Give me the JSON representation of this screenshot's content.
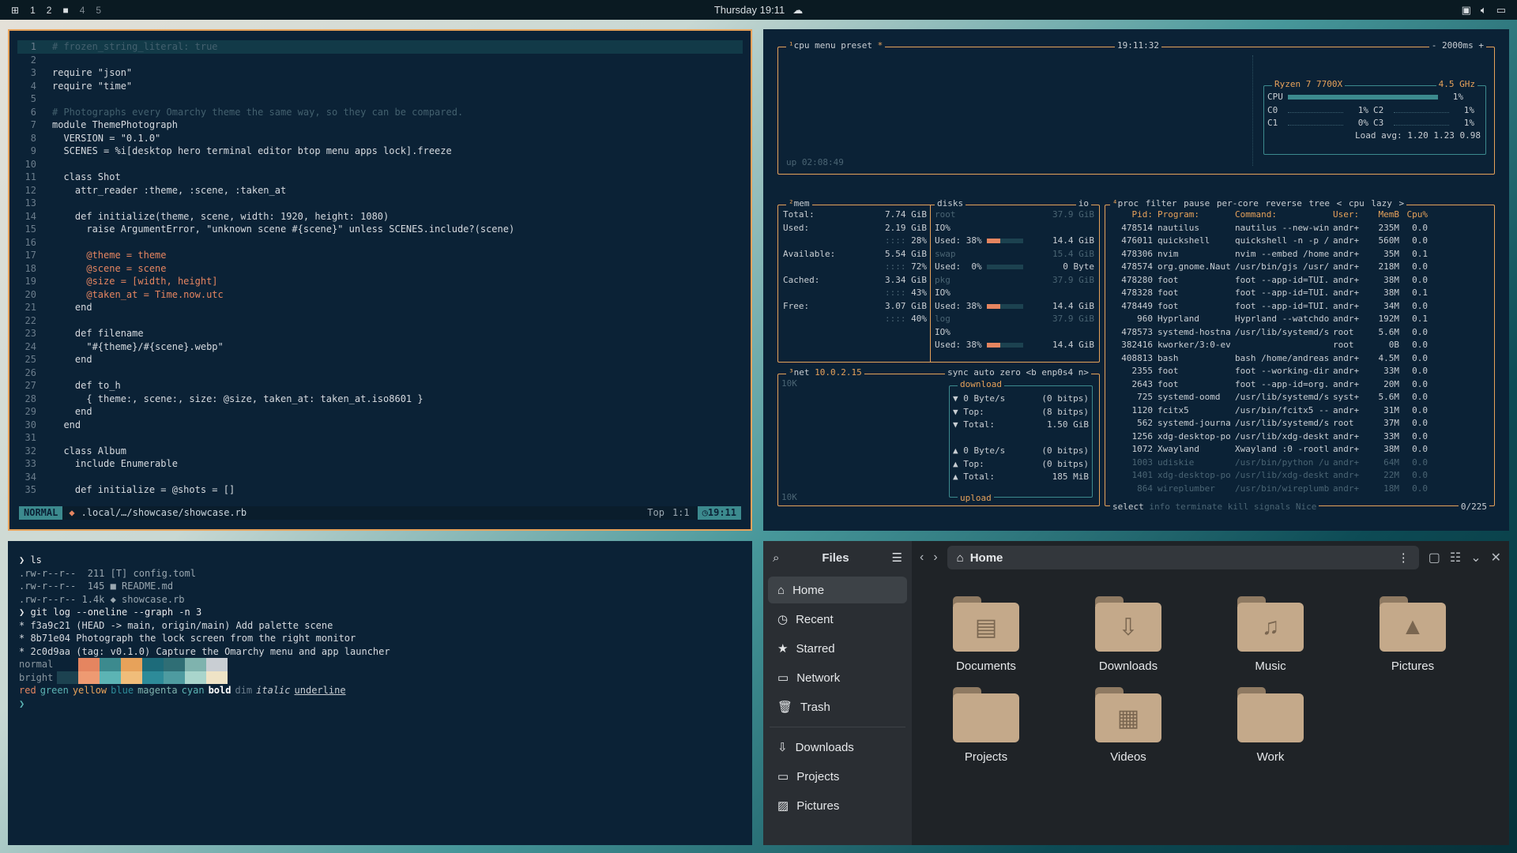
{
  "topbar": {
    "workspaces": [
      "1",
      "2",
      "3",
      "4",
      "5"
    ],
    "active_workspace": "3",
    "clock": "Thursday 19:11"
  },
  "editor": {
    "lines": [
      {
        "n": "1",
        "t": "# frozen_string_literal: true"
      },
      {
        "n": "2",
        "t": ""
      },
      {
        "n": "3",
        "t": "require \"json\""
      },
      {
        "n": "4",
        "t": "require \"time\""
      },
      {
        "n": "5",
        "t": ""
      },
      {
        "n": "6",
        "t": "# Photographs every Omarchy theme the same way, so they can be compared."
      },
      {
        "n": "7",
        "t": "module ThemePhotograph"
      },
      {
        "n": "8",
        "t": "  VERSION = \"0.1.0\""
      },
      {
        "n": "9",
        "t": "  SCENES = %i[desktop hero terminal editor btop menu apps lock].freeze"
      },
      {
        "n": "10",
        "t": ""
      },
      {
        "n": "11",
        "t": "  class Shot"
      },
      {
        "n": "12",
        "t": "    attr_reader :theme, :scene, :taken_at"
      },
      {
        "n": "13",
        "t": ""
      },
      {
        "n": "14",
        "t": "    def initialize(theme, scene, width: 1920, height: 1080)"
      },
      {
        "n": "15",
        "t": "      raise ArgumentError, \"unknown scene #{scene}\" unless SCENES.include?(scene)"
      },
      {
        "n": "16",
        "t": ""
      },
      {
        "n": "17",
        "t": "      @theme = theme"
      },
      {
        "n": "18",
        "t": "      @scene = scene"
      },
      {
        "n": "19",
        "t": "      @size = [width, height]"
      },
      {
        "n": "20",
        "t": "      @taken_at = Time.now.utc"
      },
      {
        "n": "21",
        "t": "    end"
      },
      {
        "n": "22",
        "t": ""
      },
      {
        "n": "23",
        "t": "    def filename"
      },
      {
        "n": "24",
        "t": "      \"#{theme}/#{scene}.webp\""
      },
      {
        "n": "25",
        "t": "    end"
      },
      {
        "n": "26",
        "t": ""
      },
      {
        "n": "27",
        "t": "    def to_h"
      },
      {
        "n": "28",
        "t": "      { theme:, scene:, size: @size, taken_at: taken_at.iso8601 }"
      },
      {
        "n": "29",
        "t": "    end"
      },
      {
        "n": "30",
        "t": "  end"
      },
      {
        "n": "31",
        "t": ""
      },
      {
        "n": "32",
        "t": "  class Album"
      },
      {
        "n": "33",
        "t": "    include Enumerable"
      },
      {
        "n": "34",
        "t": ""
      },
      {
        "n": "35",
        "t": "    def initialize = @shots = []"
      }
    ],
    "status": {
      "mode": "NORMAL",
      "path": ".local/…/showcase/showcase.rb",
      "pos": "Top",
      "cursor": "1:1",
      "time": "19:11"
    }
  },
  "btop": {
    "cpu": {
      "tabs": [
        "cpu",
        "menu",
        "preset"
      ],
      "time": "19:11:32",
      "rate": "2000ms",
      "model": "Ryzen 7 7700X",
      "freq": "4.5 GHz",
      "rows": [
        {
          "l": "CPU",
          "v": "1%",
          "r": "",
          "rv": ""
        },
        {
          "l": "C0",
          "v": "1%",
          "r": "C2",
          "rv": "1%"
        },
        {
          "l": "C1",
          "v": "0%",
          "r": "C3",
          "rv": "1%"
        }
      ],
      "load": "Load avg: 1.20 1.23 0.98",
      "uptime": "up 02:08:49"
    },
    "mem": {
      "title": "mem",
      "rows": [
        {
          "k": "Total:",
          "v": "7.74 GiB",
          "p": ""
        },
        {
          "k": "Used:",
          "v": "2.19 GiB",
          "p": "28%"
        },
        {
          "k": "Available:",
          "v": "5.54 GiB",
          "p": "72%"
        },
        {
          "k": "Cached:",
          "v": "3.34 GiB",
          "p": "43%"
        },
        {
          "k": "Free:",
          "v": "3.07 GiB",
          "p": "40%"
        }
      ]
    },
    "disks": {
      "title": "disks",
      "io": "io",
      "rows": [
        {
          "name": "root",
          "size": "37.9 GiB",
          "io": "IO%",
          "used": "Used: 38%",
          "usedv": "14.4 GiB",
          "pct": 0.38
        },
        {
          "name": "swap",
          "size": "15.4 GiB",
          "io": "",
          "used": "Used:  0%",
          "usedv": "0 Byte",
          "pct": 0.0
        },
        {
          "name": "pkg",
          "size": "37.9 GiB",
          "io": "IO%",
          "used": "Used: 38%",
          "usedv": "14.4 GiB",
          "pct": 0.38
        },
        {
          "name": "log",
          "size": "37.9 GiB",
          "io": "IO%",
          "used": "Used: 38%",
          "usedv": "14.4 GiB",
          "pct": 0.38
        }
      ]
    },
    "net": {
      "title": "net",
      "ip": "10.0.2.15",
      "opts": [
        "sync",
        "auto",
        "zero"
      ],
      "iface": "enp0s4",
      "scale_top": "10K",
      "scale_bot": "10K",
      "download_label": "download",
      "upload_label": "upload",
      "down": [
        {
          "k": "▼ 0 Byte/s",
          "v": "(0 bitps)"
        },
        {
          "k": "▼ Top:",
          "v": "(8 bitps)"
        },
        {
          "k": "▼ Total:",
          "v": "1.50 GiB"
        }
      ],
      "up": [
        {
          "k": "▲ 0 Byte/s",
          "v": "(0 bitps)"
        },
        {
          "k": "▲ Top:",
          "v": "(0 bitps)"
        },
        {
          "k": "▲ Total:",
          "v": "185 MiB"
        }
      ]
    },
    "proc": {
      "tabs": [
        "proc",
        "filter",
        "pause",
        "per-core",
        "reverse",
        "tree",
        "< cpu lazy >"
      ],
      "headers": [
        "Pid:",
        "Program:",
        "Command:",
        "User:",
        "MemB",
        "Cpu%"
      ],
      "rows": [
        [
          "478514",
          "nautilus",
          "nautilus --new-win",
          "andr+",
          "235M",
          "0.0"
        ],
        [
          "476011",
          "quickshell",
          "quickshell -n -p /",
          "andr+",
          "560M",
          "0.0"
        ],
        [
          "478306",
          "nvim",
          "nvim --embed /home",
          "andr+",
          "35M",
          "0.1"
        ],
        [
          "478574",
          "org.gnome.Nauti",
          "/usr/bin/gjs /usr/",
          "andr+",
          "218M",
          "0.0"
        ],
        [
          "478280",
          "foot",
          "foot --app-id=TUI.",
          "andr+",
          "38M",
          "0.0"
        ],
        [
          "478328",
          "foot",
          "foot --app-id=TUI.",
          "andr+",
          "38M",
          "0.1"
        ],
        [
          "478449",
          "foot",
          "foot --app-id=TUI.",
          "andr+",
          "34M",
          "0.0"
        ],
        [
          "960",
          "Hyprland",
          "Hyprland --watchdo",
          "andr+",
          "192M",
          "0.1"
        ],
        [
          "478573",
          "systemd-hostnam",
          "/usr/lib/systemd/s",
          "root",
          "5.6M",
          "0.0"
        ],
        [
          "382416",
          "kworker/3:0-even",
          "",
          "root",
          "0B",
          "0.0"
        ],
        [
          "408813",
          "bash",
          "bash /home/andreas",
          "andr+",
          "4.5M",
          "0.0"
        ],
        [
          "2355",
          "foot",
          "foot --working-dir",
          "andr+",
          "33M",
          "0.0"
        ],
        [
          "2643",
          "foot",
          "foot --app-id=org.",
          "andr+",
          "20M",
          "0.0"
        ],
        [
          "725",
          "systemd-oomd",
          "/usr/lib/systemd/s",
          "syst+",
          "5.6M",
          "0.0"
        ],
        [
          "1120",
          "fcitx5",
          "/usr/bin/fcitx5 --",
          "andr+",
          "31M",
          "0.0"
        ],
        [
          "562",
          "systemd-journal",
          "/usr/lib/systemd/s",
          "root",
          "37M",
          "0.0"
        ],
        [
          "1256",
          "xdg-desktop-por",
          "/usr/lib/xdg-deskt",
          "andr+",
          "33M",
          "0.0"
        ],
        [
          "1072",
          "Xwayland",
          "Xwayland :0 -rootl",
          "andr+",
          "38M",
          "0.0"
        ],
        [
          "1003",
          "udiskie",
          "/usr/bin/python /u",
          "andr+",
          "64M",
          "0.0"
        ],
        [
          "1401",
          "xdg-desktop-por",
          "/usr/lib/xdg-deskt",
          "andr+",
          "22M",
          "0.0"
        ],
        [
          "864",
          "wireplumber",
          "/usr/bin/wireplumb",
          "andr+",
          "18M",
          "0.0"
        ]
      ],
      "footer": [
        "select",
        "info",
        "terminate",
        "kill",
        "signals",
        "Nice"
      ],
      "count": "0/225"
    }
  },
  "terminal": {
    "lines": [
      {
        "t": "❯ ls"
      },
      {
        "t": ".rw-r--r--  211 [T] config.toml"
      },
      {
        "t": ".rw-r--r--  145 ■ README.md"
      },
      {
        "t": ".rw-r--r-- 1.4k ◆ showcase.rb"
      },
      {
        "t": "❯ git log --oneline --graph -n 3"
      },
      {
        "t": "* f3a9c21 (HEAD -> main, origin/main) Add palette scene"
      },
      {
        "t": "* 8b71e04 Photograph the lock screen from the right monitor"
      },
      {
        "t": "* 2c0d9aa (tag: v0.1.0) Capture the Omarchy menu and app launcher"
      }
    ],
    "normal_label": "normal",
    "bright_label": "bright",
    "normal_colors": [
      "#0b2236",
      "#e58560",
      "#3c8a8e",
      "#e7a25a",
      "#1d6b7a",
      "#2f6e75",
      "#7fb3ae",
      "#c9ced3"
    ],
    "bright_colors": [
      "#1c4250",
      "#ee9a72",
      "#5cb4b4",
      "#f0bd7a",
      "#2d8b99",
      "#4e9ba0",
      "#a9d5cc",
      "#efe3c6"
    ],
    "styles": [
      "red",
      "green",
      "yellow",
      "blue",
      "magenta",
      "cyan",
      "bold",
      "dim",
      "italic",
      "underline"
    ],
    "prompt": "❯"
  },
  "files": {
    "title": "Files",
    "location": "Home",
    "sidebar": [
      "Home",
      "Recent",
      "Starred",
      "Network",
      "Trash"
    ],
    "bookmarks": [
      "Downloads",
      "Projects",
      "Pictures"
    ],
    "folders": [
      {
        "name": "Documents",
        "icon": "document-icon",
        "glyph": "▤"
      },
      {
        "name": "Downloads",
        "icon": "download-icon",
        "glyph": "⇩"
      },
      {
        "name": "Music",
        "icon": "music-icon",
        "glyph": "♫"
      },
      {
        "name": "Pictures",
        "icon": "picture-icon",
        "glyph": "▲"
      },
      {
        "name": "Projects",
        "icon": "folder-icon",
        "glyph": ""
      },
      {
        "name": "Videos",
        "icon": "video-icon",
        "glyph": "▦"
      },
      {
        "name": "Work",
        "icon": "folder-icon",
        "glyph": ""
      }
    ]
  },
  "colors": {
    "accent": "#e7a25a",
    "teal": "#5cb4b4",
    "bg": "#0b2236"
  }
}
